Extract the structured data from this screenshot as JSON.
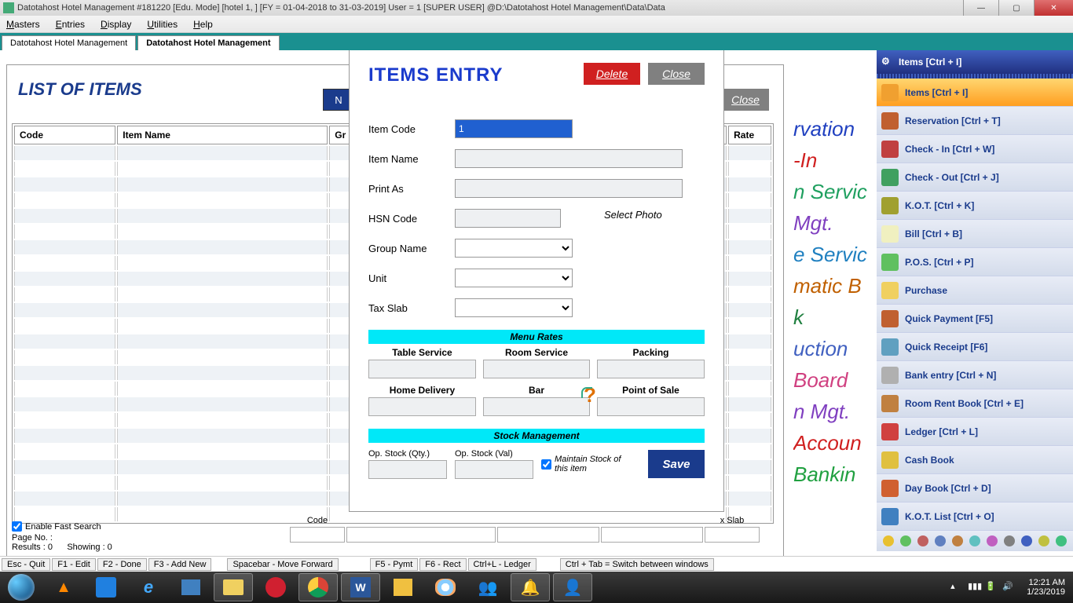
{
  "window": {
    "title": "Datotahost Hotel Management #181220  [Edu. Mode]  [hotel 1, ] [FY = 01-04-2018 to 31-03-2019] User = 1 [SUPER USER]  @D:\\Datotahost Hotel Management\\Data\\Data"
  },
  "menu": {
    "masters": "Masters",
    "entries": "Entries",
    "display": "Display",
    "utilities": "Utilities",
    "help": "Help"
  },
  "tabs": {
    "t1": "Datotahost Hotel Management",
    "t2": "Datotahost Hotel Management"
  },
  "list": {
    "title": "LIST OF ITEMS",
    "close": "Close",
    "newbtn": "N",
    "cols": {
      "code": "Code",
      "name": "Item Name",
      "group": "Gr",
      "rate": "Rate"
    },
    "enable_fast": "Enable Fast Search",
    "page_no": "Page No. :",
    "results": "Results : 0",
    "showing": "Showing :   0",
    "bottom": {
      "code": "Code",
      "slab": "x Slab"
    }
  },
  "modal": {
    "title": "ITEMS ENTRY",
    "delete": "Delete",
    "close": "Close",
    "labels": {
      "code": "Item Code",
      "name": "Item Name",
      "print": "Print As",
      "hsn": "HSN Code",
      "group": "Group Name",
      "unit": "Unit",
      "tax": "Tax Slab",
      "photo": "Select Photo"
    },
    "values": {
      "code": "1"
    },
    "menu_rates": "Menu Rates",
    "rates": {
      "table": "Table Service",
      "room": "Room Service",
      "packing": "Packing",
      "home": "Home Delivery",
      "bar": "Bar",
      "pos": "Point of Sale"
    },
    "stock_mgmt": "Stock Management",
    "stock": {
      "qty": "Op. Stock (Qty.)",
      "val": "Op. Stock (Val)",
      "maintain": "Maintain Stock of this item"
    },
    "save": "Save"
  },
  "sidebar": {
    "header": "Items [Ctrl + I]",
    "items": [
      "Items [Ctrl + I]",
      "Reservation [Ctrl + T]",
      "Check - In [Ctrl + W]",
      "Check - Out [Ctrl + J]",
      "K.O.T. [Ctrl + K]",
      "Bill [Ctrl + B]",
      "P.O.S. [Ctrl + P]",
      "Purchase",
      "Quick Payment [F5]",
      "Quick Receipt [F6]",
      "Bank entry [Ctrl + N]",
      "Room Rent Book [Ctrl + E]",
      "Ledger [Ctrl + L]",
      "Cash Book",
      "Day Book [Ctrl + D]",
      "K.O.T. List [Ctrl + O]"
    ]
  },
  "bgtext": [
    {
      "t": "rvation",
      "c": "#2040c0"
    },
    {
      "t": "-In",
      "c": "#d02020"
    },
    {
      "t": "n Servic",
      "c": "#20a060"
    },
    {
      "t": "Mgt.",
      "c": "#8040c0"
    },
    {
      "t": "e Servic",
      "c": "#2080c0"
    },
    {
      "t": "matic B",
      "c": "#c06000"
    },
    {
      "t": "k",
      "c": "#208040"
    },
    {
      "t": "uction",
      "c": "#4060c0"
    },
    {
      "t": "Board",
      "c": "#d04080"
    },
    {
      "t": "n Mgt.",
      "c": "#8040c0"
    },
    {
      "t": "Accoun",
      "c": "#d02020"
    },
    {
      "t": "Bankin",
      "c": "#20a040"
    }
  ],
  "keybar": [
    "Esc - Quit",
    "F1 - Edit",
    "F2 - Done",
    "F3 - Add New",
    "Spacebar - Move Forward",
    "F5 - Pymt",
    "F6 - Rect",
    "Ctrl+L - Ledger",
    "Ctrl + Tab = Switch between windows"
  ],
  "clock": {
    "time": "12:21 AM",
    "date": "1/23/2019"
  }
}
